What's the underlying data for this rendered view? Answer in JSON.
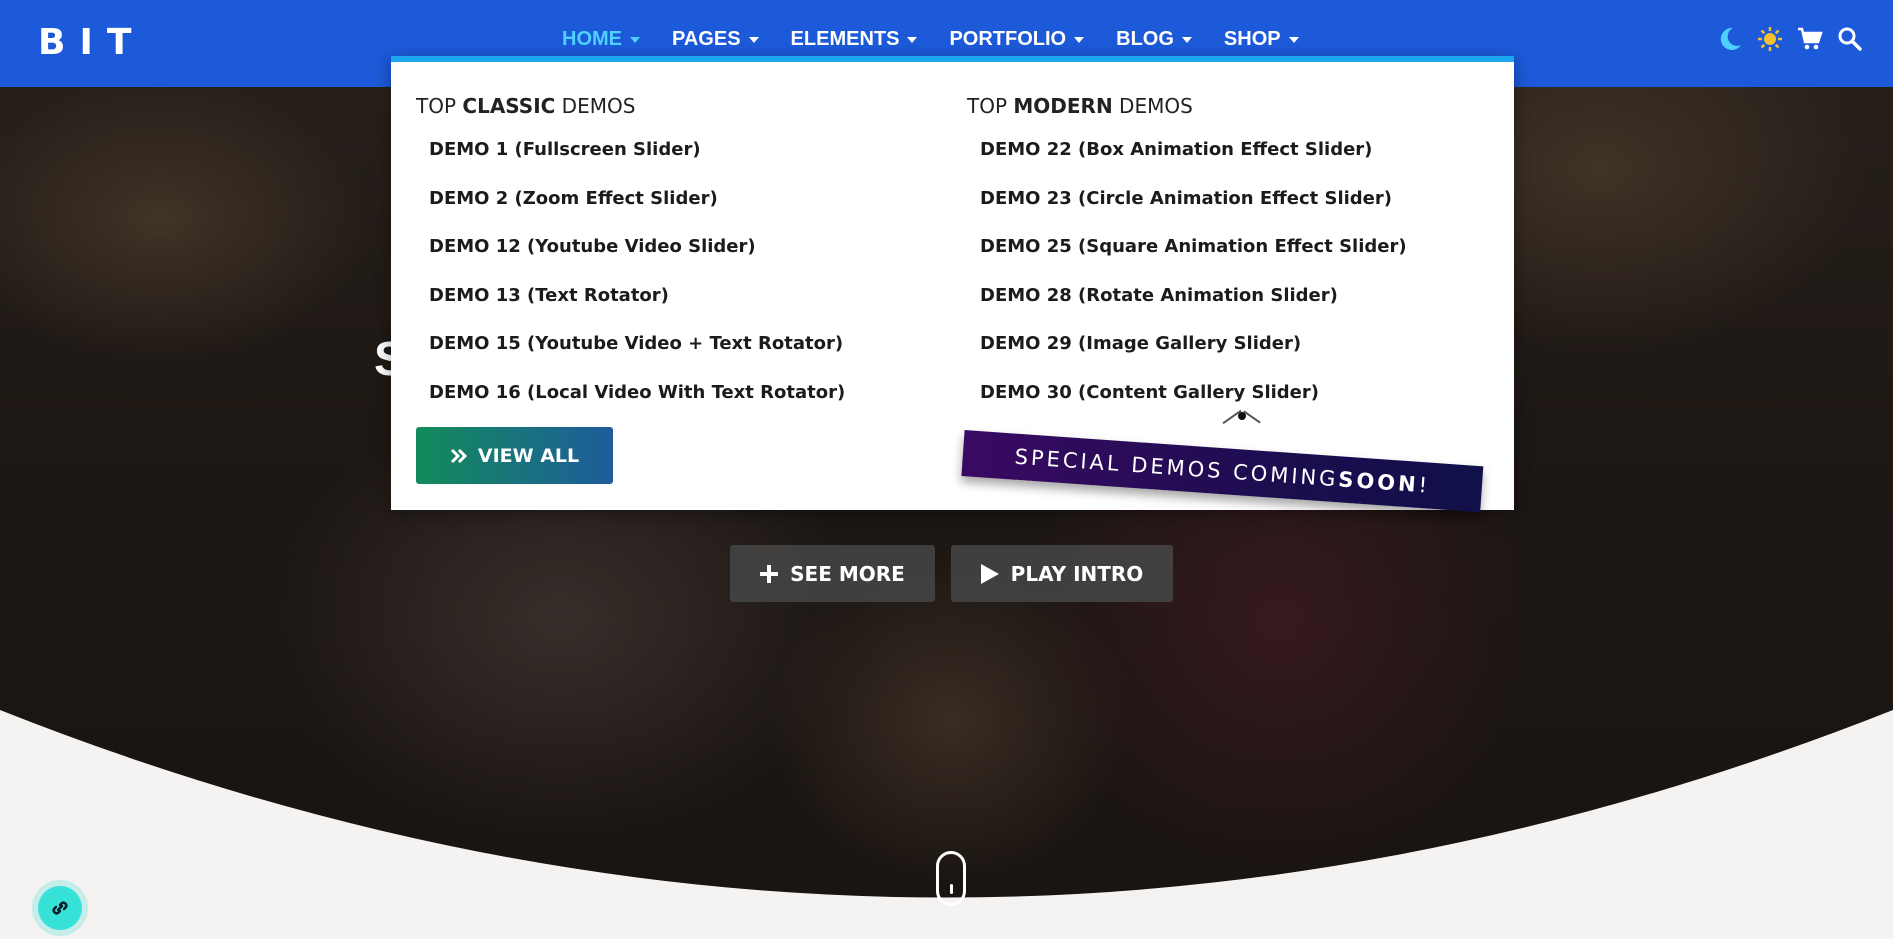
{
  "header": {
    "logo": "BIT",
    "nav": [
      {
        "label": "HOME",
        "active": true
      },
      {
        "label": "PAGES"
      },
      {
        "label": "ELEMENTS"
      },
      {
        "label": "PORTFOLIO"
      },
      {
        "label": "BLOG"
      },
      {
        "label": "SHOP"
      }
    ],
    "icons": [
      "moon-icon",
      "sun-icon",
      "cart-icon",
      "search-icon"
    ]
  },
  "mega": {
    "classic": {
      "heading_pre": "TOP ",
      "heading_bold": "CLASSIC",
      "heading_post": " DEMOS",
      "items": [
        "DEMO 1 (Fullscreen Slider)",
        "DEMO 2 (Zoom Effect Slider)",
        "DEMO 12 (Youtube Video Slider)",
        "DEMO 13 (Text Rotator)",
        "DEMO 15 (Youtube Video + Text Rotator)",
        "DEMO 16 (Local Video With Text Rotator)"
      ]
    },
    "modern": {
      "heading_pre": "TOP ",
      "heading_bold": "MODERN",
      "heading_post": " DEMOS",
      "items": [
        "DEMO 22 (Box Animation Effect Slider)",
        "DEMO 23 (Circle Animation Effect Slider)",
        "DEMO 25 (Square Animation Effect Slider)",
        "DEMO 28 (Rotate Animation Slider)",
        "DEMO 29 (Image Gallery Slider)",
        "DEMO 30 (Content Gallery Slider)"
      ]
    },
    "view_all": "VIEW ALL",
    "ribbon_pre": "SPECIAL DEMOS COMING ",
    "ribbon_bold": "SOON",
    "ribbon_post": "!"
  },
  "hero": {
    "heading_partial": "S",
    "see_more": "SEE MORE",
    "play_intro": "PLAY INTRO"
  },
  "colors": {
    "header": "#1c5ad9",
    "active_nav": "#4fd1ff",
    "menu_accent": "#1aa7f0"
  }
}
